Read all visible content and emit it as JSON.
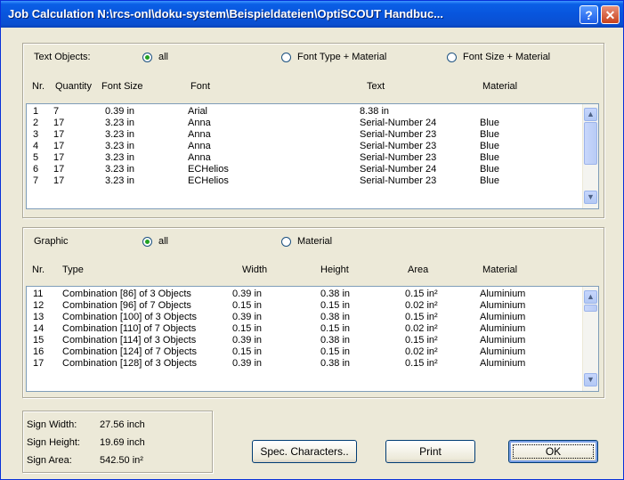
{
  "window": {
    "title": "Job Calculation  N:\\rcs-onl\\doku-system\\Beispieldateien\\OptiSCOUT Handbuc...",
    "help_label": "?",
    "close_label": "✕"
  },
  "text_objects": {
    "label": "Text Objects:",
    "filters": [
      {
        "label": "all",
        "selected": true
      },
      {
        "label": "Font Type + Material",
        "selected": false
      },
      {
        "label": "Font Size + Material",
        "selected": false
      }
    ],
    "columns": {
      "nr": "Nr.",
      "quantity": "Quantity",
      "font_size": "Font Size",
      "font": "Font",
      "text": "Text",
      "material": "Material"
    },
    "rows": [
      {
        "nr": "1",
        "quantity": "7",
        "font_size": "0.39 in",
        "font": "Arial",
        "text": "8.38 in",
        "material": ""
      },
      {
        "nr": "2",
        "quantity": "17",
        "font_size": "3.23 in",
        "font": "Anna",
        "text": "Serial-Number 24",
        "material": "Blue"
      },
      {
        "nr": "3",
        "quantity": "17",
        "font_size": "3.23 in",
        "font": "Anna",
        "text": "Serial-Number 23",
        "material": "Blue"
      },
      {
        "nr": "4",
        "quantity": "17",
        "font_size": "3.23 in",
        "font": "Anna",
        "text": "Serial-Number 23",
        "material": "Blue"
      },
      {
        "nr": "5",
        "quantity": "17",
        "font_size": "3.23 in",
        "font": "Anna",
        "text": "Serial-Number 23",
        "material": "Blue"
      },
      {
        "nr": "6",
        "quantity": "17",
        "font_size": "3.23 in",
        "font": "ECHelios",
        "text": "Serial-Number 24",
        "material": "Blue"
      },
      {
        "nr": "7",
        "quantity": "17",
        "font_size": "3.23 in",
        "font": "ECHelios",
        "text": "Serial-Number 23",
        "material": "Blue"
      }
    ]
  },
  "graphic": {
    "label": "Graphic",
    "filters": [
      {
        "label": "all",
        "selected": true
      },
      {
        "label": "Material",
        "selected": false
      }
    ],
    "columns": {
      "nr": "Nr.",
      "type": "Type",
      "width": "Width",
      "height": "Height",
      "area": "Area",
      "material": "Material"
    },
    "rows": [
      {
        "nr": "11",
        "type": "Combination [86] of 3 Objects",
        "width": "0.39 in",
        "height": "0.38 in",
        "area": "0.15 in²",
        "material": "Aluminium"
      },
      {
        "nr": "12",
        "type": "Combination [96] of 7 Objects",
        "width": "0.15 in",
        "height": "0.15 in",
        "area": "0.02 in²",
        "material": "Aluminium"
      },
      {
        "nr": "13",
        "type": "Combination [100] of 3 Objects",
        "width": "0.39 in",
        "height": "0.38 in",
        "area": "0.15 in²",
        "material": "Aluminium"
      },
      {
        "nr": "14",
        "type": "Combination [110] of 7 Objects",
        "width": "0.15 in",
        "height": "0.15 in",
        "area": "0.02 in²",
        "material": "Aluminium"
      },
      {
        "nr": "15",
        "type": "Combination [114] of 3 Objects",
        "width": "0.39 in",
        "height": "0.38 in",
        "area": "0.15 in²",
        "material": "Aluminium"
      },
      {
        "nr": "16",
        "type": "Combination [124] of 7 Objects",
        "width": "0.15 in",
        "height": "0.15 in",
        "area": "0.02 in²",
        "material": "Aluminium"
      },
      {
        "nr": "17",
        "type": "Combination [128] of 3 Objects",
        "width": "0.39 in",
        "height": "0.38 in",
        "area": "0.15 in²",
        "material": "Aluminium"
      }
    ]
  },
  "sign": {
    "width_label": "Sign Width:",
    "width_value": "27.56 inch",
    "height_label": "Sign Height:",
    "height_value": "19.69 inch",
    "area_label": "Sign Area:",
    "area_value": "542.50 in²"
  },
  "buttons": {
    "spec_chars": "Spec. Characters..",
    "print": "Print",
    "ok": "OK"
  },
  "icons": {
    "scroll_up": "arrow-up-icon",
    "scroll_down": "arrow-down-icon"
  }
}
